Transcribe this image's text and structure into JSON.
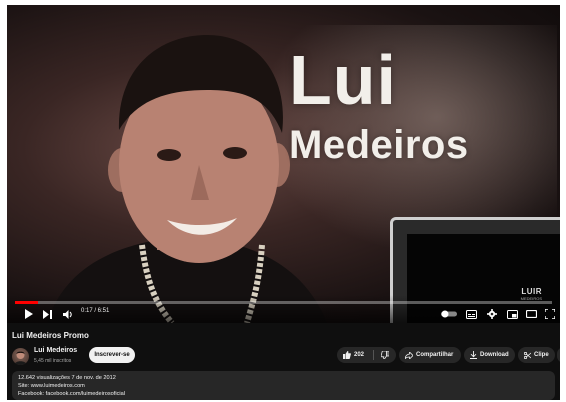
{
  "video": {
    "overlay_title_line1": "Lui",
    "overlay_title_line2": "Medeiros",
    "watermark": "LUIR",
    "watermark_sub": "MEDEIROS",
    "time": "0:17 / 6:51",
    "progress_fraction": 0.043
  },
  "controls": {
    "icons": [
      "play-icon",
      "next-icon",
      "volume-icon",
      "autoplay-toggle-icon",
      "captions-icon",
      "settings-icon",
      "miniplayer-icon",
      "theater-icon",
      "fullscreen-icon"
    ]
  },
  "info": {
    "title": "Lui Medeiros Promo",
    "channel_name": "Lui Medeiros",
    "subscribers": "5,45 mil inscritos",
    "subscribe_label": "Inscrever-se",
    "like_count": "202",
    "share_label": "Compartilhar",
    "download_label": "Download",
    "clip_label": "Clipe"
  },
  "description": {
    "stats": "12.642 visualizações  7 de nov. de 2012",
    "site": "Site: www.luimedeiros.com",
    "facebook": "Facebook: facebook.com/luimedeirosoficial"
  },
  "colors": {
    "progress": "#ff0000",
    "background": "#0f0f0f",
    "pill": "#272727"
  }
}
